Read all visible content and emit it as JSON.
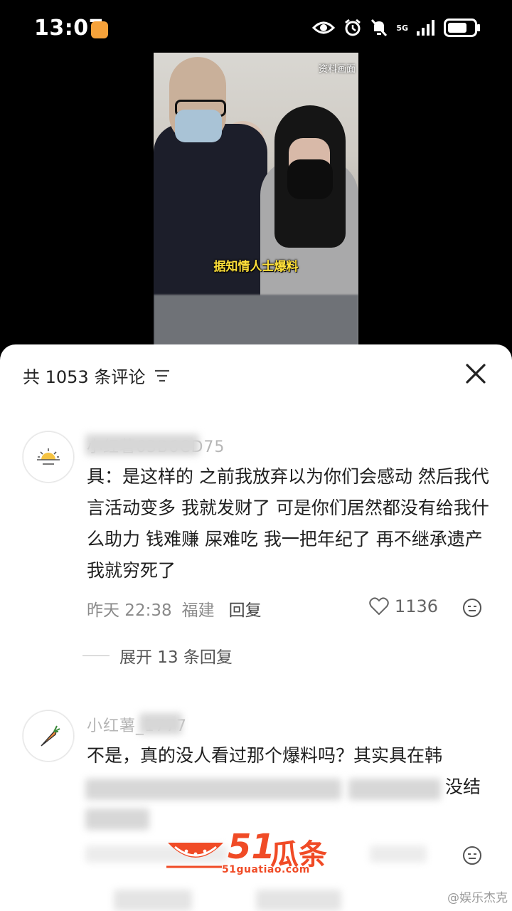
{
  "status_bar": {
    "time": "13:07",
    "network": "5G",
    "icons": [
      "eye-icon",
      "alarm-icon",
      "mute-icon",
      "signal-icon",
      "battery-icon"
    ]
  },
  "video": {
    "corner_label": "资料画面",
    "caption": "据知情人士爆料"
  },
  "comments_panel": {
    "header": "共 1053 条评论",
    "close_icon": "close-icon",
    "comments": [
      {
        "username": "小红薯63B6CD75",
        "avatar_icon": "sun-icon",
        "text": "具：是这样的 之前我放弃以为你们会感动 然后我代言活动变多 我就发财了 可是你们居然都没有给我什么助力 钱难赚 屎难吃 我一把年纪了 再不继承遗产 我就穷死了",
        "time": "昨天 22:38",
        "location": "福建",
        "reply_label": "回复",
        "likes": "1136",
        "expand_label": "展开 13 条回复"
      },
      {
        "username": "小红薯_1777",
        "avatar_icon": "carrot-icon",
        "text_line1": "不是，真的没人看过那个爆料吗？其实具在韩",
        "text_line2_tail": "没结"
      }
    ]
  },
  "watermark": {
    "number": "51",
    "name": "瓜条",
    "url": "51guatiao.com"
  },
  "corner_watermark": "@娱乐杰克"
}
